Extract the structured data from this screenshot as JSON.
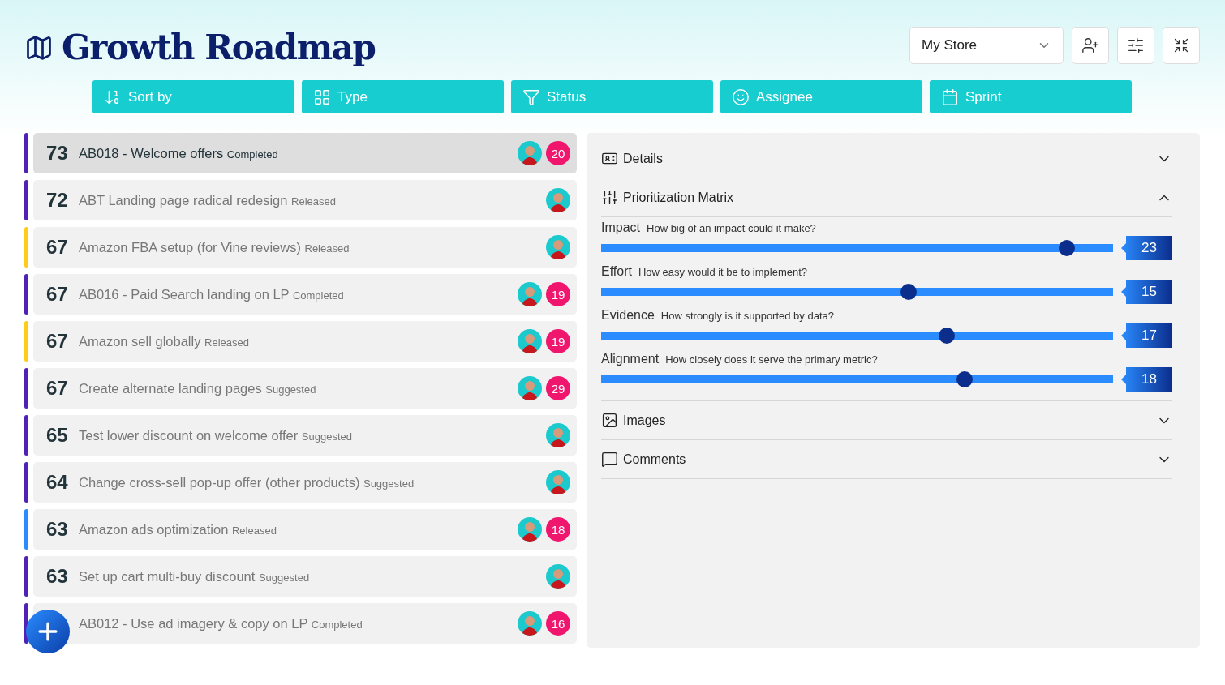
{
  "header": {
    "title": "Growth Roadmap",
    "store_select": {
      "value": "My Store"
    }
  },
  "filters": [
    {
      "kind": "sort",
      "label": "Sort by"
    },
    {
      "kind": "type",
      "label": "Type"
    },
    {
      "kind": "status",
      "label": "Status"
    },
    {
      "kind": "assignee",
      "label": "Assignee"
    },
    {
      "kind": "sprint",
      "label": "Sprint"
    }
  ],
  "items": [
    {
      "score": "73",
      "title": "AB018 - Welcome offers",
      "status": "Completed",
      "color": "#4f22b5",
      "count": "20",
      "selected": true
    },
    {
      "score": "72",
      "title": "ABT Landing page radical redesign",
      "status": "Released",
      "color": "#4f22b5",
      "selected": false
    },
    {
      "score": "67",
      "title": "Amazon FBA setup (for Vine reviews)",
      "status": "Released",
      "color": "#ffcc1a",
      "selected": false
    },
    {
      "score": "67",
      "title": "AB016 - Paid Search landing on LP",
      "status": "Completed",
      "color": "#4f22b5",
      "count": "19",
      "selected": false
    },
    {
      "score": "67",
      "title": "Amazon sell globally",
      "status": "Released",
      "color": "#ffcc1a",
      "count": "19",
      "selected": false
    },
    {
      "score": "67",
      "title": "Create alternate landing pages",
      "status": "Suggested",
      "color": "#4f22b5",
      "count": "29",
      "selected": false
    },
    {
      "score": "65",
      "title": "Test lower discount on welcome offer",
      "status": "Suggested",
      "color": "#4f22b5",
      "selected": false
    },
    {
      "score": "64",
      "title": "Change cross-sell pop-up offer (other products)",
      "status": "Suggested",
      "color": "#4f22b5",
      "selected": false
    },
    {
      "score": "63",
      "title": "Amazon ads optimization",
      "status": "Released",
      "color": "#2a8cff",
      "count": "18",
      "selected": false
    },
    {
      "score": "63",
      "title": "Set up cart multi-buy discount",
      "status": "Suggested",
      "color": "#4f22b5",
      "selected": false
    },
    {
      "title": "AB012 - Use ad imagery & copy on LP",
      "status": "Completed",
      "color": "#4f22b5",
      "count": "16",
      "selected": false
    }
  ],
  "sections": [
    {
      "kind": "details",
      "label": "Details",
      "expanded": false
    },
    {
      "kind": "matrix",
      "label": "Prioritization Matrix",
      "expanded": true,
      "sliders": [
        {
          "label": "Impact",
          "question": "How big of an impact could it make?",
          "level": 0.91,
          "value": "23"
        },
        {
          "label": "Effort",
          "question": "How easy would it be to implement?",
          "level": 0.6,
          "value": "15"
        },
        {
          "label": "Evidence",
          "question": "How strongly is it supported by data?",
          "level": 0.675,
          "value": "17"
        },
        {
          "label": "Alignment",
          "question": "How closely does it serve the primary metric?",
          "level": 0.71,
          "value": "18"
        }
      ]
    },
    {
      "kind": "images",
      "label": "Images",
      "expanded": false
    },
    {
      "kind": "comments",
      "label": "Comments",
      "expanded": false
    }
  ]
}
